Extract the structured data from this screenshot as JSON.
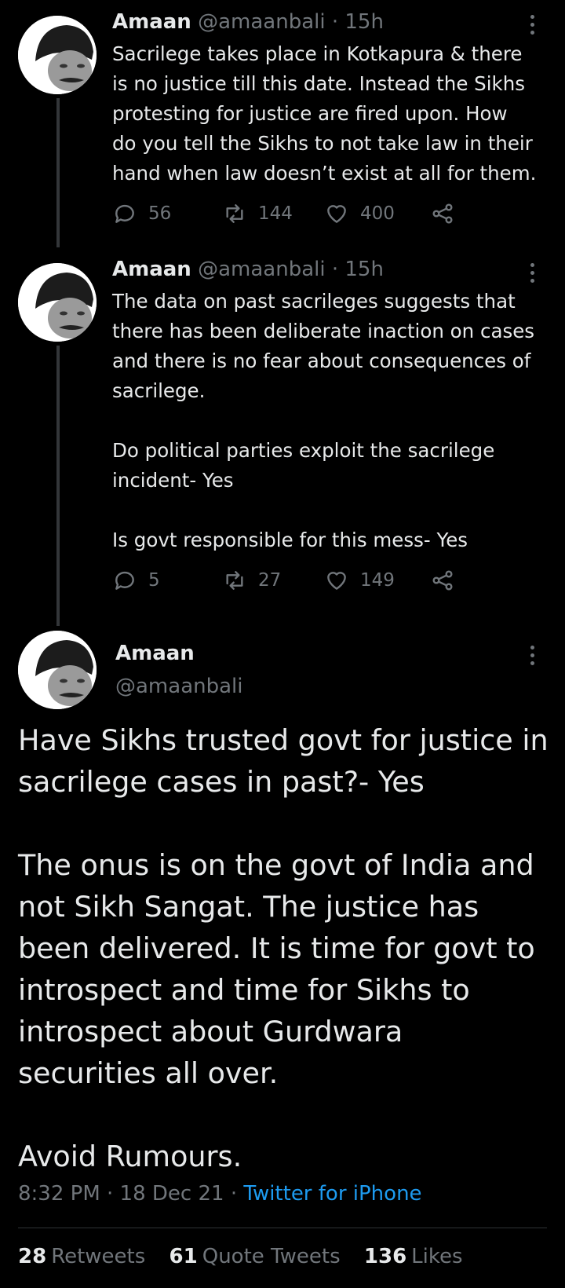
{
  "tweets": [
    {
      "name": "Amaan",
      "handle": "@amaanbali",
      "time": "· 15h",
      "text": "Sacrilege takes place in Kotkapura & there\nis no justice till this date. Instead the Sikhs\nprotesting for justice are fired upon. How\ndo you tell the Sikhs to not take law in their\nhand when law doesn’t exist at all for them.",
      "replies": "56",
      "retweets": "144",
      "likes": "400"
    },
    {
      "name": "Amaan",
      "handle": "@amaanbali",
      "time": "· 15h",
      "text": "The data on past sacrileges suggests that\nthere has been deliberate inaction on cases\nand there is no fear about consequences of\nsacrilege.\n\nDo political parties exploit the sacrilege\nincident- Yes\n\nIs govt responsible for this mess- Yes",
      "replies": "5",
      "retweets": "27",
      "likes": "149"
    }
  ],
  "main": {
    "name": "Amaan",
    "handle": "@amaanbali",
    "text": "Have Sikhs trusted govt for justice in\nsacrilege cases in past?- Yes\n\nThe onus is on the govt of India and\nnot Sikh Sangat. The justice has\nbeen delivered. It is time for govt to\nintrospect and time for Sikhs to\nintrospect about Gurdwara\nsecurities all over.\n\nAvoid Rumours.",
    "time": "8:32 PM · 18 Dec 21 · ",
    "source": "Twitter for iPhone",
    "retweets_count": "28",
    "retweets_label": "Retweets",
    "quotes_count": "61",
    "quotes_label": "Quote Tweets",
    "likes_count": "136",
    "likes_label": "Likes"
  },
  "icons": {
    "reply": "reply-icon",
    "retweet": "retweet-icon",
    "like": "heart-icon",
    "share": "share-icon",
    "more": "more-icon"
  },
  "colors": {
    "background": "#000000",
    "text": "#e7e9ea",
    "muted": "#71767b",
    "link": "#1d9bf0"
  }
}
